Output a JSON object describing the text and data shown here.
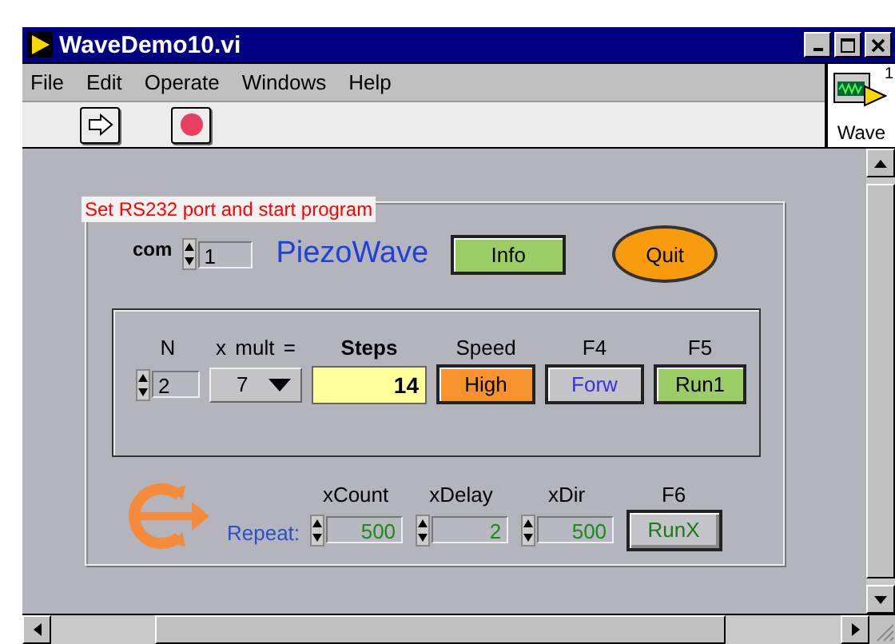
{
  "window": {
    "title": "WaveDemo10.vi"
  },
  "menu": [
    "File",
    "Edit",
    "Operate",
    "Windows",
    "Help"
  ],
  "connector_pane": {
    "label": "Wave",
    "number": "1"
  },
  "panel": {
    "label": "Set RS232 port and start program",
    "com": {
      "label": "com",
      "value": "1"
    },
    "title": "PiezoWave",
    "info_button": "Info",
    "quit_button": "Quit",
    "steps": {
      "n_label": "N",
      "times": "x",
      "mult_label": "mult",
      "equals": "=",
      "steps_label": "Steps",
      "n_value": "2",
      "mult_value": "7",
      "steps_value": "14"
    },
    "buttons": [
      {
        "heading": "Speed",
        "label": "High",
        "color": "#f7922e",
        "kind": "speed"
      },
      {
        "heading": "F4",
        "label": "Forw",
        "color": "#c4c4c8",
        "kind": "direction"
      },
      {
        "heading": "F5",
        "label": "Run1",
        "color": "#9ccc66",
        "kind": "run"
      }
    ],
    "repeat": {
      "label": "Repeat:",
      "fields": [
        {
          "heading": "xCount",
          "value": "500"
        },
        {
          "heading": "xDelay",
          "value": "2"
        },
        {
          "heading": "xDir",
          "value": "500"
        }
      ],
      "button": {
        "heading": "F6",
        "label": "RunX",
        "color": "#c4c4c8",
        "kind": "repeat"
      }
    }
  }
}
